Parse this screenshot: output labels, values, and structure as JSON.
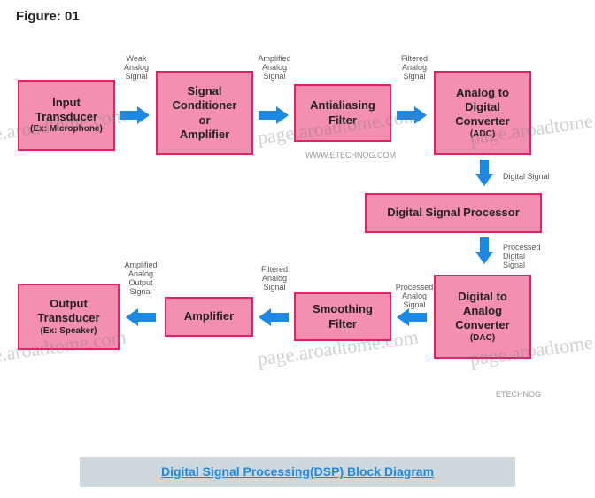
{
  "figure_label": "Figure: 01",
  "blocks": {
    "input_transducer": {
      "line1": "Input",
      "line2": "Transducer",
      "sub": "(Ex: Microphone)"
    },
    "signal_cond": {
      "line1": "Signal",
      "line2": "Conditioner",
      "line3": "or",
      "line4": "Amplifier"
    },
    "antialias": {
      "line1": "Antialiasing",
      "line2": "Filter"
    },
    "adc": {
      "line1": "Analog to",
      "line2": "Digital",
      "line3": "Converter",
      "sub": "(ADC)"
    },
    "dsp": {
      "line1": "Digital Signal Processor"
    },
    "dac": {
      "line1": "Digital to",
      "line2": "Analog",
      "line3": "Converter",
      "sub": "(DAC)"
    },
    "smoothing": {
      "line1": "Smoothing",
      "line2": "Filter"
    },
    "amplifier": {
      "line1": "Amplifier"
    },
    "output_transducer": {
      "line1": "Output",
      "line2": "Transducer",
      "sub": "(Ex: Speaker)"
    }
  },
  "arrow_labels": {
    "a1": "Weak\nAnalog\nSignal",
    "a2": "Amplified\nAnalog\nSignal",
    "a3": "Filtered\nAnalog\nSignal",
    "a4": "Digital Signal",
    "a5": "Processed\nDigital\nSignal",
    "a6": "Processed\nAnalog\nSignal",
    "a7": "Filtered\nAnalog\nSignal",
    "a8": "Amplified\nAnalog\nOutput\nSignal"
  },
  "site_credit": "WWW.ETECHNOG.COM",
  "caption": "Digital Signal Processing(DSP) Block Diagram",
  "corner_credit": "ETECHNOG",
  "watermark_text": "page.aroadtome.com"
}
